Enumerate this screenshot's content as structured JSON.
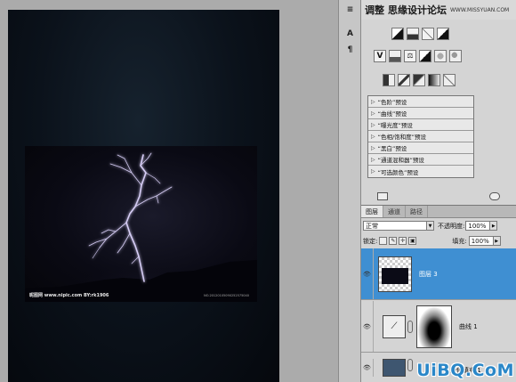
{
  "site_banner": {
    "title": "思缘设计论坛",
    "url": "WWW.MISSYUAN.COM",
    "panel_tab": "调整"
  },
  "canvas": {
    "photo_watermark": "昵图网 www.nipic.com BY:rk1906",
    "photo_credit": "NO.20120105090252575040"
  },
  "adjustments": {
    "presets": [
      "“色阶”预设",
      "“曲线”预设",
      "“曝光度”预设",
      "“色相/饱和度”预设",
      "“黑白”预设",
      "“通道混和器”预设",
      "“可选颜色”预设"
    ]
  },
  "layers_panel": {
    "tabs": [
      "图层",
      "通道",
      "路径"
    ],
    "blend_mode": "正常",
    "opacity_label": "不透明度:",
    "opacity_value": "100%",
    "lock_label": "锁定:",
    "fill_label": "填充:",
    "fill_value": "100%",
    "layers": [
      {
        "name": "图层 3",
        "selected": true
      },
      {
        "name": "曲线 1",
        "selected": false
      },
      {
        "name": "颜色填充 1",
        "selected": false
      }
    ]
  },
  "corner_watermark": "UiBQ.CoM",
  "colors": {
    "selected_layer": "#3f8fd2",
    "panel_bg": "#d4d4d4",
    "canvas_bg": "#ababab"
  }
}
